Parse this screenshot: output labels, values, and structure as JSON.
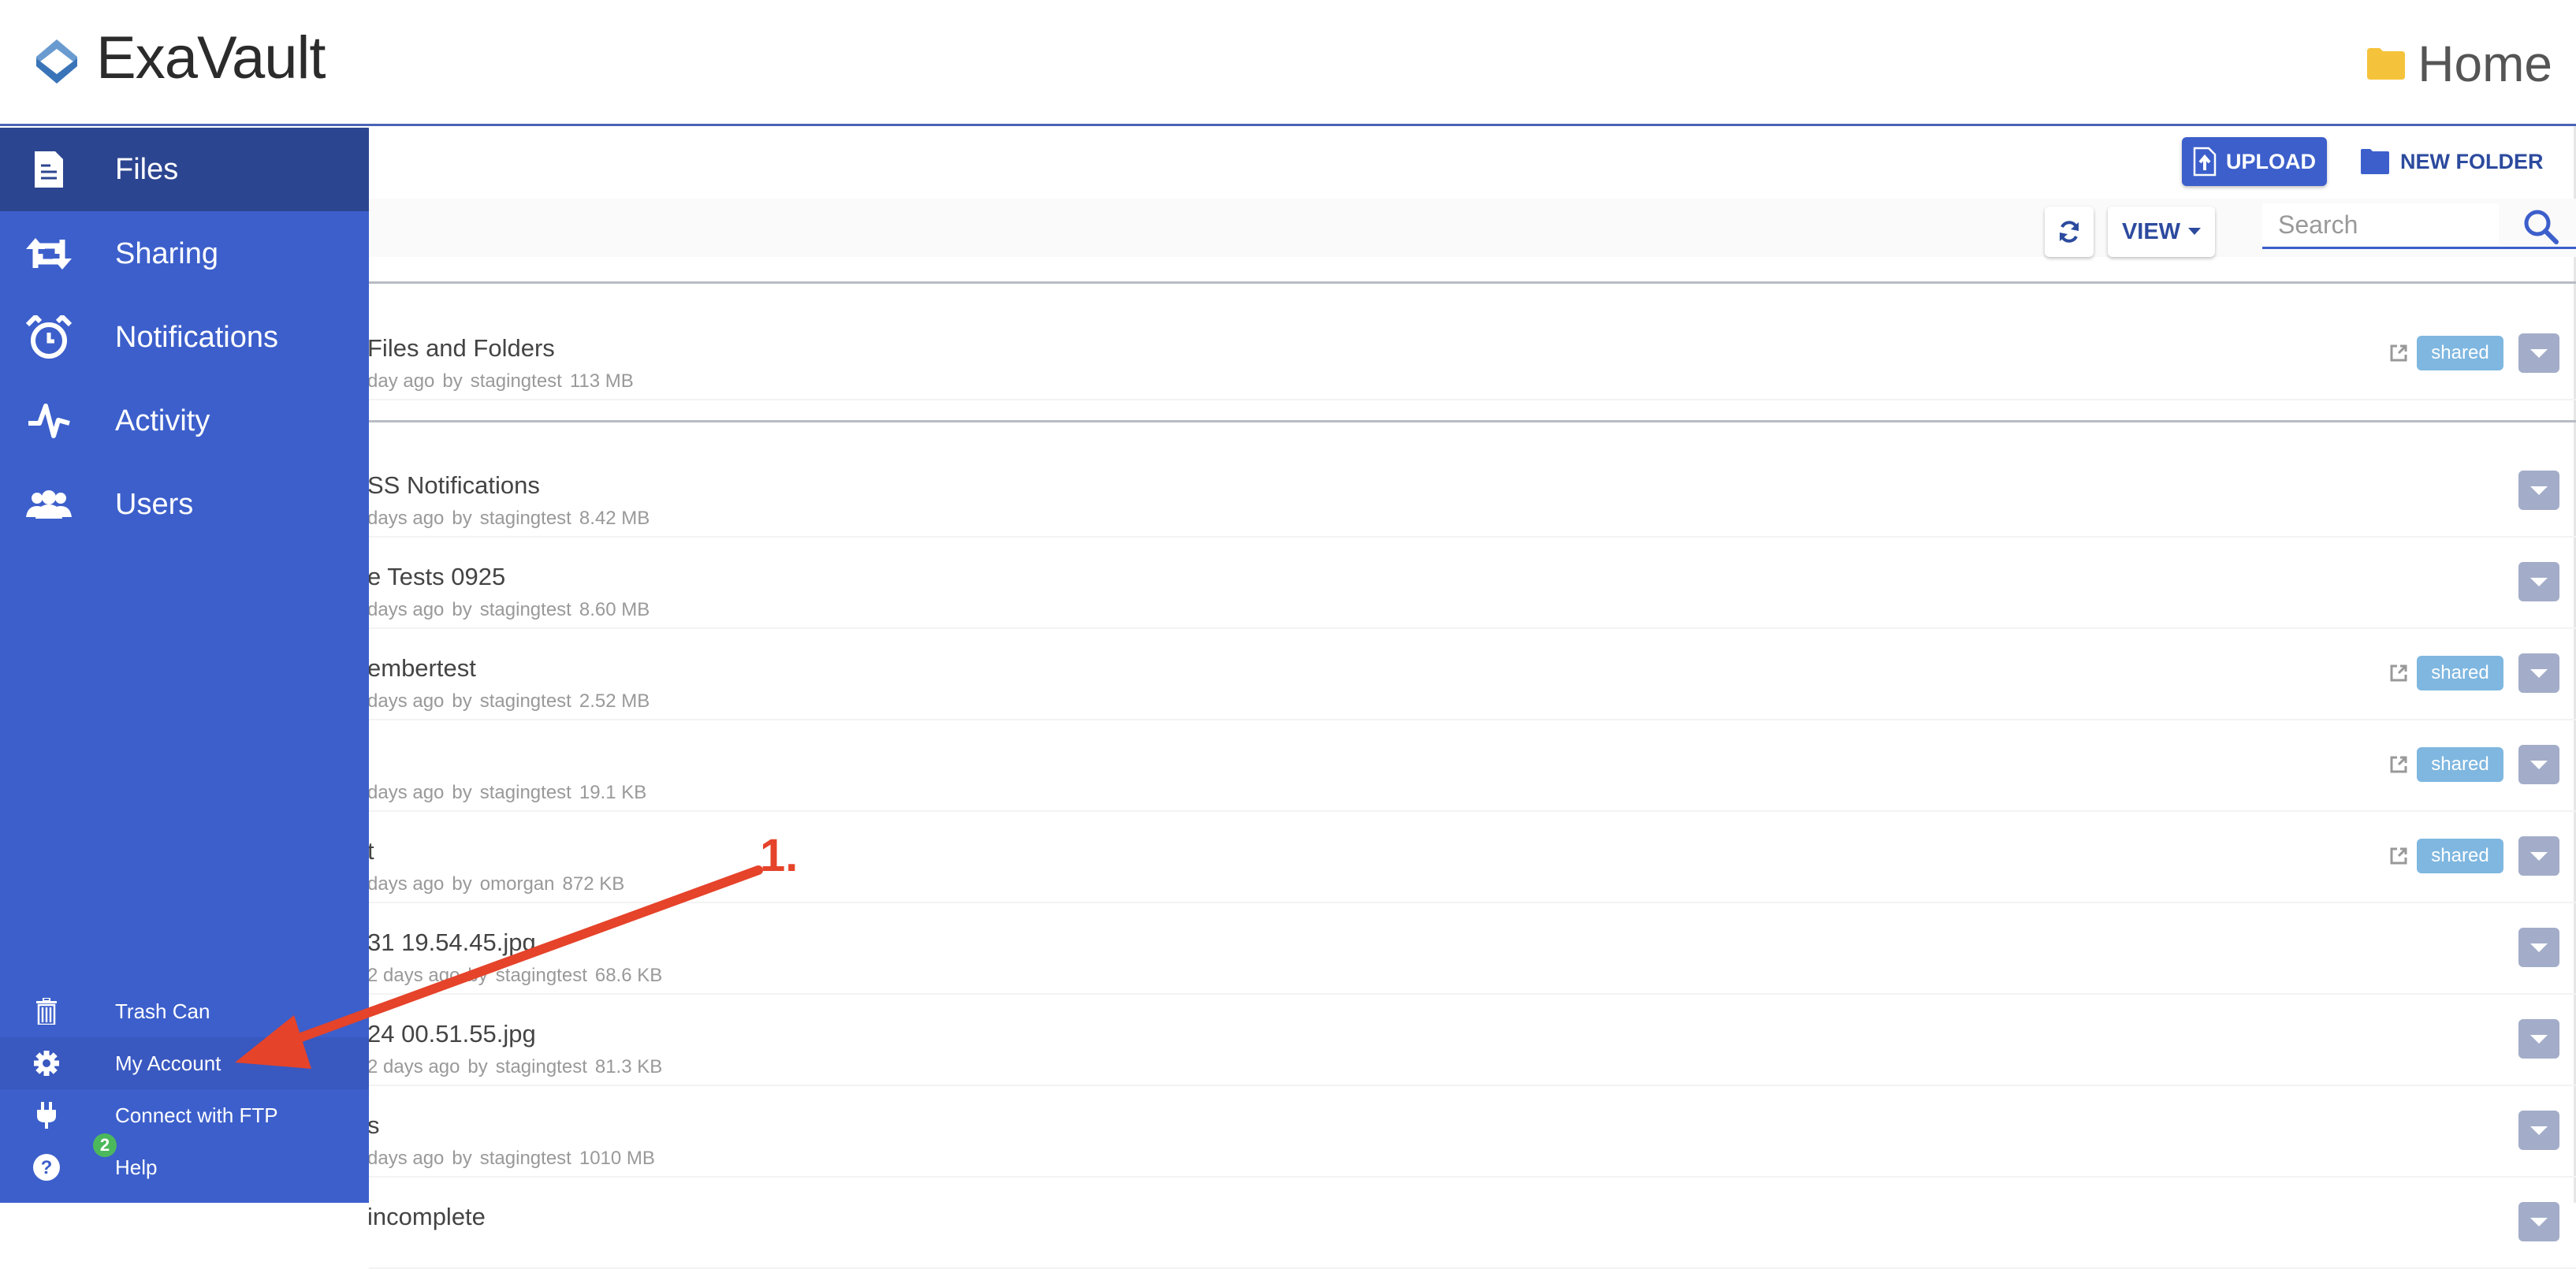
{
  "header": {
    "brand": "ExaVault",
    "breadcrumb": "Home",
    "folder_icon": "folder-icon",
    "accent_color": "#3c5fcb"
  },
  "actions": {
    "upload_label": "UPLOAD",
    "new_folder_label": "NEW FOLDER",
    "view_label": "VIEW",
    "search_placeholder": "Search",
    "search_value": ""
  },
  "sidebar": {
    "nav": [
      {
        "label": "Files",
        "icon": "file-icon",
        "active": true
      },
      {
        "label": "Sharing",
        "icon": "share-arrows-icon",
        "active": false
      },
      {
        "label": "Notifications",
        "icon": "alarm-clock-icon",
        "active": false
      },
      {
        "label": "Activity",
        "icon": "pulse-icon",
        "active": false
      },
      {
        "label": "Users",
        "icon": "users-icon",
        "active": false
      }
    ],
    "bottom": [
      {
        "label": "Trash Can",
        "icon": "trash-icon"
      },
      {
        "label": "My Account",
        "icon": "gear-icon",
        "highlighted": true
      },
      {
        "label": "Connect with FTP",
        "icon": "plug-icon"
      },
      {
        "label": "Help",
        "icon": "help-icon",
        "badge": "2"
      }
    ]
  },
  "pinned_rows": [
    {
      "name": "Files and Folders",
      "time": "day ago",
      "by": "by",
      "owner": "stagingtest",
      "size": "113 MB",
      "shared": true
    }
  ],
  "rows": [
    {
      "name": "SS Notifications",
      "time": "days ago",
      "by": "by",
      "owner": "stagingtest",
      "size": "8.42 MB",
      "shared": false
    },
    {
      "name": "e Tests 0925",
      "time": "days ago",
      "by": "by",
      "owner": "stagingtest",
      "size": "8.60 MB",
      "shared": false
    },
    {
      "name": "embertest",
      "time": "days ago",
      "by": "by",
      "owner": "stagingtest",
      "size": "2.52 MB",
      "shared": true
    },
    {
      "name": "",
      "time": "days ago",
      "by": "by",
      "owner": "stagingtest",
      "size": "19.1 KB",
      "shared": true
    },
    {
      "name": "t",
      "time": "days ago",
      "by": "by",
      "owner": "omorgan",
      "size": "872 KB",
      "shared": true
    },
    {
      "name": "31 19.54.45.jpg",
      "time": "2 days ago",
      "by": "by",
      "owner": "stagingtest",
      "size": "68.6 KB",
      "shared": false
    },
    {
      "name": "24 00.51.55.jpg",
      "time": "2 days ago",
      "by": "by",
      "owner": "stagingtest",
      "size": "81.3 KB",
      "shared": false
    },
    {
      "name": "s",
      "time": "days ago",
      "by": "by",
      "owner": "stagingtest",
      "size": "1010 MB",
      "shared": false
    },
    {
      "name": "incomplete",
      "time": "",
      "by": "",
      "owner": "",
      "size": "",
      "shared": false
    }
  ],
  "shared_label": "shared",
  "annotation": {
    "label": "1.",
    "color": "#e5432a",
    "target": "My Account"
  }
}
